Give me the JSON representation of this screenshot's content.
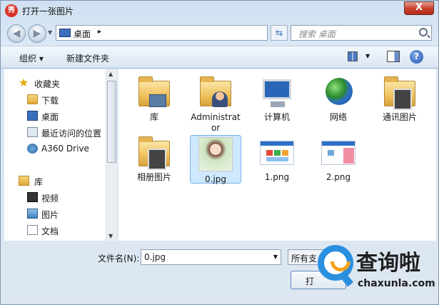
{
  "window": {
    "title": "打开一张图片",
    "app_icon": "秀",
    "close_label": "X"
  },
  "address": {
    "location": "桌面",
    "arrow": "▸"
  },
  "search": {
    "placeholder": "搜索 桌面"
  },
  "toolbar": {
    "organize": "组织 ▾",
    "new_folder": "新建文件夹",
    "help": "?"
  },
  "sidebar": {
    "items": [
      {
        "label": "收藏夹",
        "icon": "star-icon"
      },
      {
        "label": "下载",
        "icon": "downloads-folder-icon"
      },
      {
        "label": "桌面",
        "icon": "desktop-icon"
      },
      {
        "label": "最近访问的位置",
        "icon": "recent-places-icon"
      },
      {
        "label": "A360 Drive",
        "icon": "a360-drive-icon"
      },
      {
        "label": "库",
        "icon": "library-icon"
      },
      {
        "label": "视频",
        "icon": "video-icon"
      },
      {
        "label": "图片",
        "icon": "pictures-icon"
      },
      {
        "label": "文档",
        "icon": "documents-icon"
      }
    ]
  },
  "files": [
    {
      "name": "库",
      "icon": "library-folder-icon"
    },
    {
      "name": "Administrator",
      "icon": "user-folder-icon"
    },
    {
      "name": "计算机",
      "icon": "computer-icon"
    },
    {
      "name": "网络",
      "icon": "network-icon"
    },
    {
      "name": "通讯图片",
      "icon": "photo-folder-icon"
    },
    {
      "name": "相册图片",
      "icon": "album-folder-icon"
    },
    {
      "name": "0.jpg",
      "icon": "jpg-thumbnail",
      "selected": true
    },
    {
      "name": "1.png",
      "icon": "png-thumbnail"
    },
    {
      "name": "2.png",
      "icon": "png-thumbnail"
    }
  ],
  "footer": {
    "filename_label": "文件名(N):",
    "filename_value": "0.jpg",
    "filetype_value": "所有支",
    "open_label": "打"
  },
  "watermark": {
    "title": "查询啦",
    "url": "chaxunla.com"
  },
  "colors": {
    "accent": "#2b8fe0",
    "selection": "#cde8ff",
    "close": "#c7432e"
  }
}
